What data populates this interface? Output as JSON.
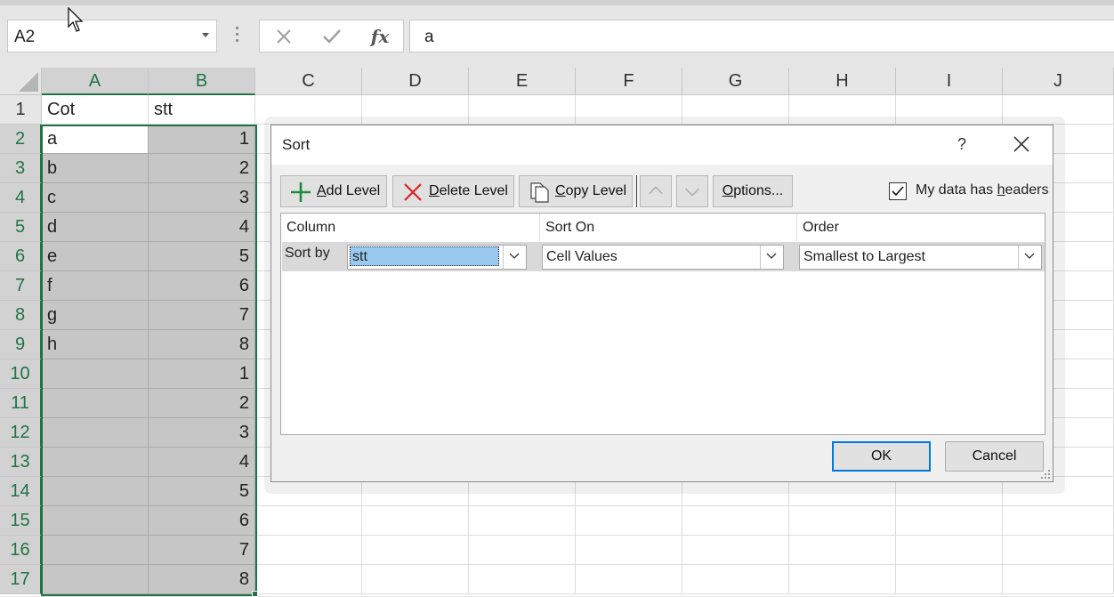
{
  "formula_bar": {
    "name_box": "A2",
    "cancel_icon": "x-icon",
    "enter_icon": "check-icon",
    "fx_label": "fx",
    "formula_value": "a"
  },
  "columns": [
    "A",
    "B",
    "C",
    "D",
    "E",
    "F",
    "G",
    "H",
    "I",
    "J"
  ],
  "selected_columns": [
    "A",
    "B"
  ],
  "rows": [
    {
      "num": "1",
      "a": "Cot",
      "b": "stt"
    },
    {
      "num": "2",
      "a": "a",
      "b": "1"
    },
    {
      "num": "3",
      "a": "b",
      "b": "2"
    },
    {
      "num": "4",
      "a": "c",
      "b": "3"
    },
    {
      "num": "5",
      "a": "d",
      "b": "4"
    },
    {
      "num": "6",
      "a": "e",
      "b": "5"
    },
    {
      "num": "7",
      "a": "f",
      "b": "6"
    },
    {
      "num": "8",
      "a": "g",
      "b": "7"
    },
    {
      "num": "9",
      "a": "h",
      "b": "8"
    },
    {
      "num": "10",
      "a": "",
      "b": "1"
    },
    {
      "num": "11",
      "a": "",
      "b": "2"
    },
    {
      "num": "12",
      "a": "",
      "b": "3"
    },
    {
      "num": "13",
      "a": "",
      "b": "4"
    },
    {
      "num": "14",
      "a": "",
      "b": "5"
    },
    {
      "num": "15",
      "a": "",
      "b": "6"
    },
    {
      "num": "16",
      "a": "",
      "b": "7"
    },
    {
      "num": "17",
      "a": "",
      "b": "8"
    }
  ],
  "dialog": {
    "title": "Sort",
    "help": "?",
    "add_level": {
      "pre": "",
      "key": "A",
      "post": "dd Level"
    },
    "delete_level": {
      "pre": "",
      "key": "D",
      "post": "elete Level"
    },
    "copy_level": {
      "pre": "",
      "key": "C",
      "post": "opy Level"
    },
    "options": {
      "pre": "",
      "key": "O",
      "post": "ptions..."
    },
    "has_headers": {
      "pre": "My data has ",
      "key": "h",
      "post": "eaders",
      "checked": true
    },
    "col_header_column": "Column",
    "col_header_sort_on": "Sort On",
    "col_header_order": "Order",
    "level": {
      "label": "Sort by",
      "column": "stt",
      "sort_on": "Cell Values",
      "order": "Smallest to Largest"
    },
    "ok": "OK",
    "cancel": "Cancel"
  },
  "colors": {
    "accent_green": "#217346",
    "ok_border": "#0078d7",
    "selection_fill": "#c6c6c6"
  }
}
